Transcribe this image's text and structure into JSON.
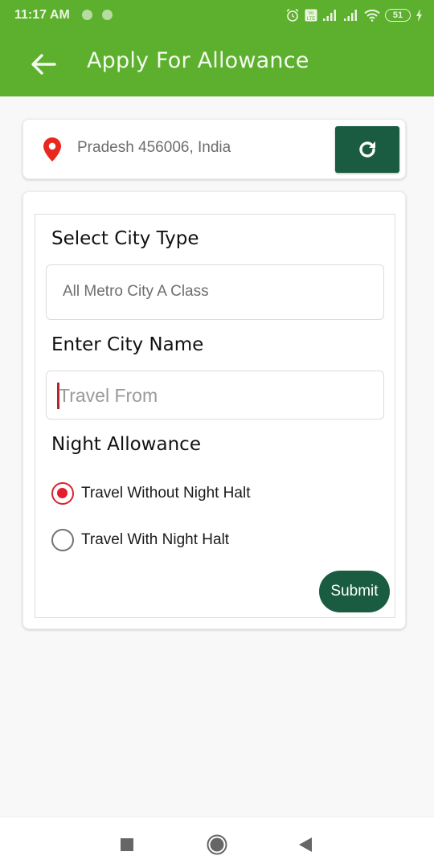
{
  "status_bar": {
    "time": "11:17 AM",
    "battery_level": "51",
    "icons": [
      "notification-dot",
      "notification-dot",
      "alarm-icon",
      "volte-icon",
      "signal-icon",
      "signal-icon",
      "wifi-icon",
      "battery-icon",
      "charging-icon"
    ]
  },
  "app_bar": {
    "title": "Apply For Allowance",
    "back_icon": "arrow-left-icon"
  },
  "location": {
    "icon": "map-pin-icon",
    "address": "Pradesh 456006, India",
    "refresh_icon": "refresh-icon"
  },
  "form": {
    "city_type": {
      "label": "Select City Type",
      "selected_value": "All Metro City A Class"
    },
    "city_name": {
      "label": "Enter City Name",
      "placeholder": "Travel From",
      "value": ""
    },
    "night_allowance": {
      "label": "Night Allowance",
      "options": [
        {
          "label": "Travel Without Night Halt",
          "checked": true
        },
        {
          "label": "Travel With Night Halt",
          "checked": false
        }
      ]
    },
    "submit_label": "Submit"
  },
  "colors": {
    "app_bar": "#5daf2e",
    "primary_button": "#1a5c41",
    "radio_selected": "#e21f2a",
    "location_pin": "#e8281e"
  },
  "nav_bar": {
    "buttons": [
      "recents-icon",
      "home-icon",
      "back-icon"
    ]
  }
}
